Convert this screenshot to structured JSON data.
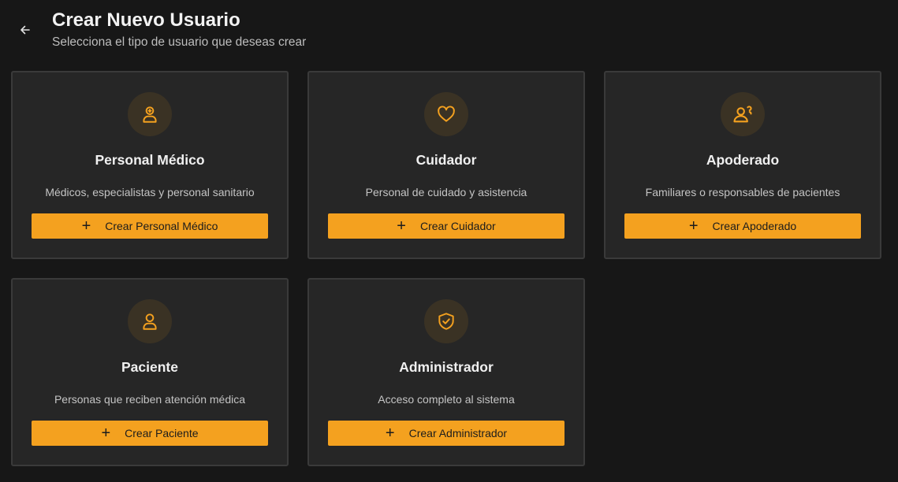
{
  "header": {
    "title": "Crear Nuevo Usuario",
    "subtitle": "Selecciona el tipo de usuario que deseas crear"
  },
  "colors": {
    "background": "#171717",
    "card": "#262626",
    "accent": "#f4a11f",
    "icon_bg": "#3a3224"
  },
  "cards": [
    {
      "icon": "medical-staff-icon",
      "title": "Personal Médico",
      "description": "Médicos, especialistas y personal sanitario",
      "button": "Crear Personal Médico"
    },
    {
      "icon": "heart-icon",
      "title": "Cuidador",
      "description": "Personal de cuidado y asistencia",
      "button": "Crear Cuidador"
    },
    {
      "icon": "guardian-icon",
      "title": "Apoderado",
      "description": "Familiares o responsables de pacientes",
      "button": "Crear Apoderado"
    },
    {
      "icon": "user-icon",
      "title": "Paciente",
      "description": "Personas que reciben atención médica",
      "button": "Crear Paciente"
    },
    {
      "icon": "shield-check-icon",
      "title": "Administrador",
      "description": "Acceso completo al sistema",
      "button": "Crear Administrador"
    }
  ]
}
